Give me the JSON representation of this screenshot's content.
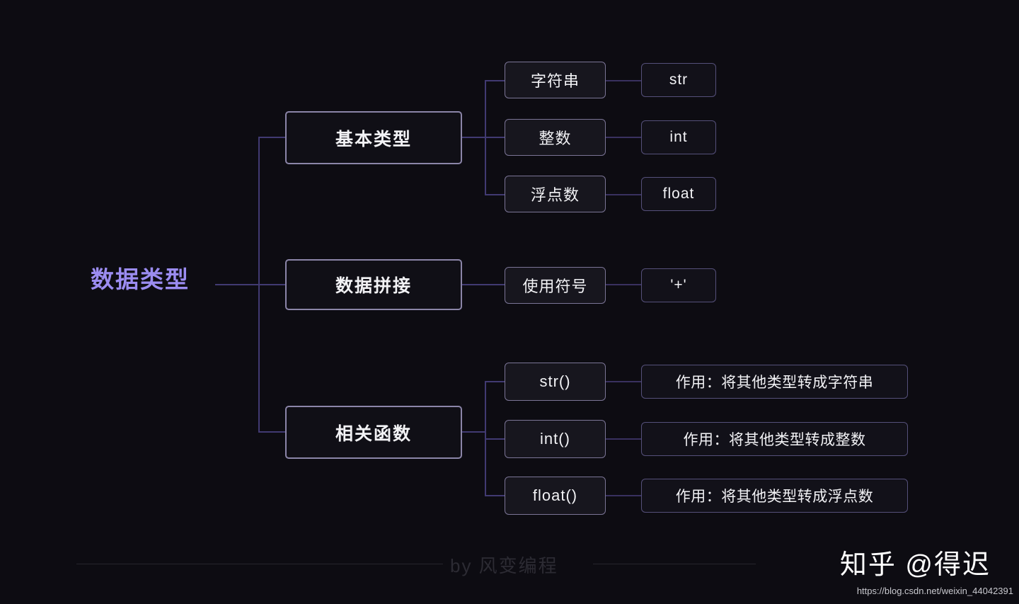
{
  "diagram": {
    "title": "数据类型",
    "root": {
      "label": "数据类型",
      "color": "#9b8cf0"
    },
    "branches": [
      {
        "label": "基本类型",
        "children": [
          {
            "label": "字符串",
            "leaf": "str"
          },
          {
            "label": "整数",
            "leaf": "int"
          },
          {
            "label": "浮点数",
            "leaf": "float"
          }
        ]
      },
      {
        "label": "数据拼接",
        "children": [
          {
            "label": "使用符号",
            "leaf": "'+'"
          }
        ]
      },
      {
        "label": "相关函数",
        "children": [
          {
            "label": "str()",
            "leaf": "作用：将其他类型转成字符串"
          },
          {
            "label": "int()",
            "leaf": "作用：将其他类型转成整数"
          },
          {
            "label": "float()",
            "leaf": "作用：将其他类型转成浮点数"
          }
        ]
      }
    ]
  },
  "footer": {
    "credit": "by 风变编程",
    "watermark": "知乎 @得迟",
    "source_url": "https://blog.csdn.net/weixin_44042391"
  },
  "theme": {
    "background": "#0d0c12",
    "accent": "#9b8cf0",
    "connector": "#413a72",
    "box_border_primary": "#8b85a8",
    "box_border_secondary": "#7b7596",
    "box_border_tertiary": "#55507a",
    "text": "#f2f2f5"
  }
}
